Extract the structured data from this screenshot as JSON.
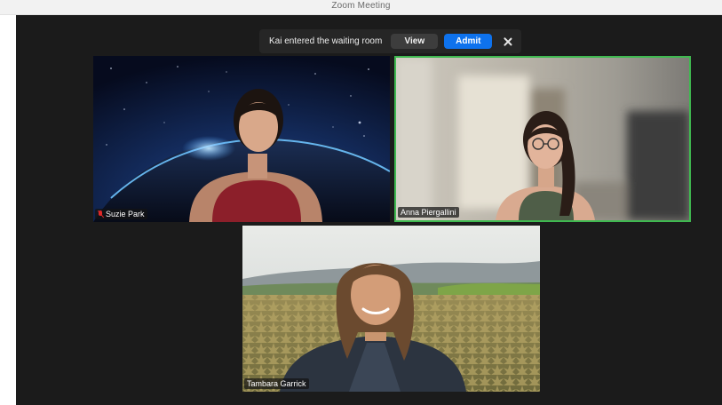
{
  "window": {
    "title": "Zoom Meeting"
  },
  "waiting_room_notice": {
    "message": "Kai entered the waiting room",
    "view_label": "View",
    "admit_label": "Admit",
    "close_icon": "close-icon"
  },
  "participants": [
    {
      "name": "Suzie Park",
      "muted": true,
      "active_speaker": false
    },
    {
      "name": "Anna Piergallini",
      "muted": false,
      "active_speaker": true
    },
    {
      "name": "Tambara Garrick",
      "muted": false,
      "active_speaker": false
    }
  ],
  "colors": {
    "admit_button": "#0e72ed",
    "active_speaker_border": "#3fb950",
    "muted_icon": "#e02828",
    "stage_background": "#1b1b1b"
  }
}
